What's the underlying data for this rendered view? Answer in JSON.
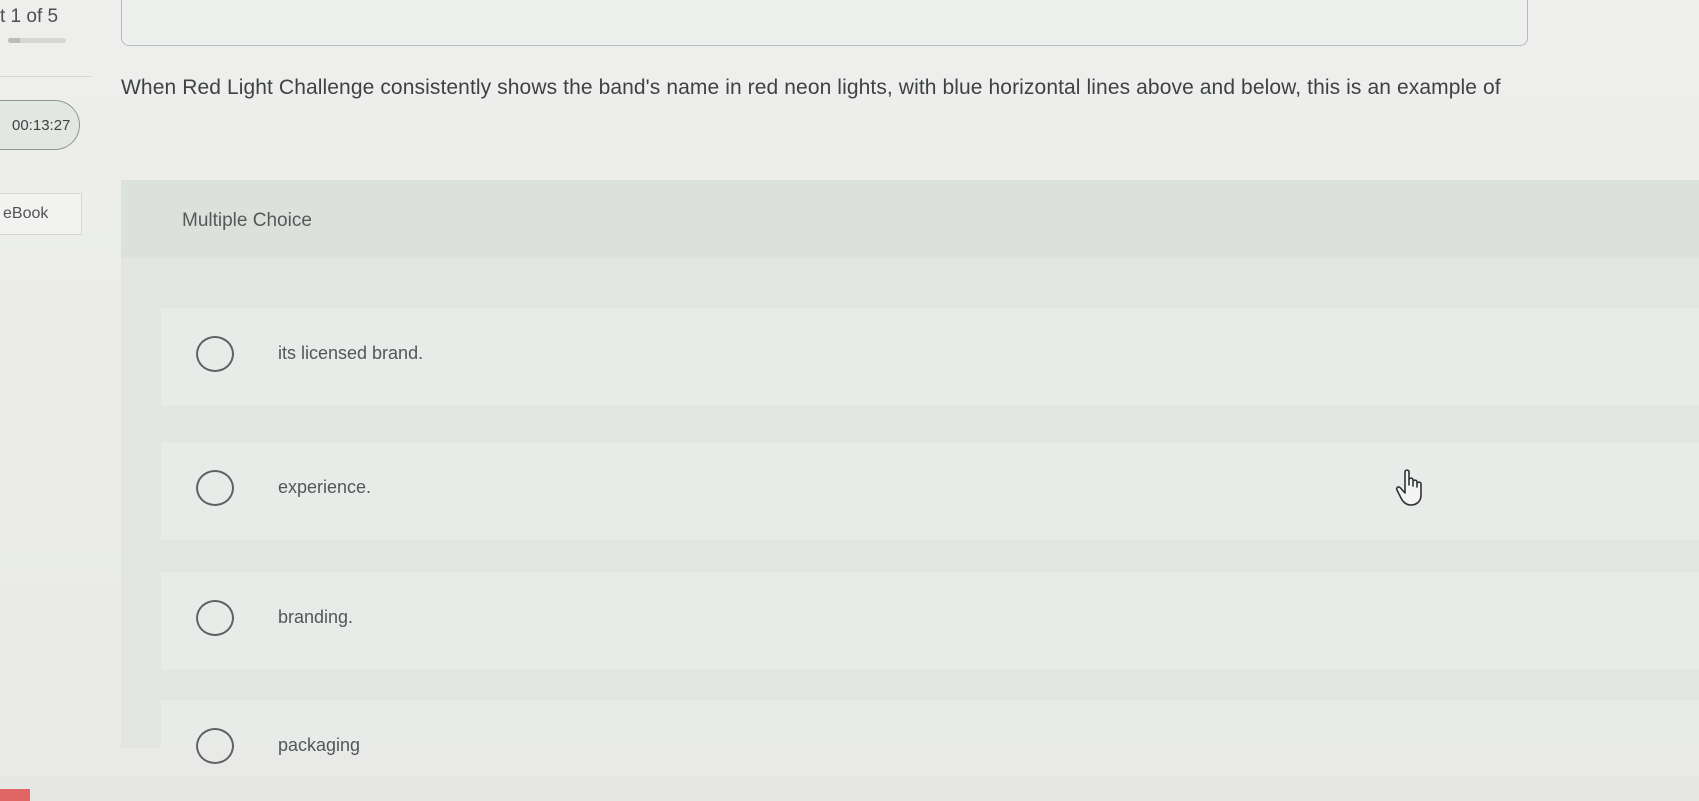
{
  "sidebar": {
    "question_counter": "t 1 of 5",
    "progress": 0.2,
    "timer": "00:13:27",
    "ebook_label": "eBook"
  },
  "question": {
    "text": "When Red Light Challenge consistently shows the band's name in red neon lights, with blue horizontal lines above and below, this is an example of",
    "type_label": "Multiple Choice",
    "options": [
      {
        "label": "its licensed brand."
      },
      {
        "label": "experience."
      },
      {
        "label": "branding."
      },
      {
        "label": "packaging"
      }
    ]
  },
  "icons": {
    "cursor": "hand-pointer-icon",
    "radio": "radio-circle-icon"
  },
  "colors": {
    "background": "#ecedeb",
    "card": "#e2e5e1",
    "accent_tab": "#e06666"
  }
}
